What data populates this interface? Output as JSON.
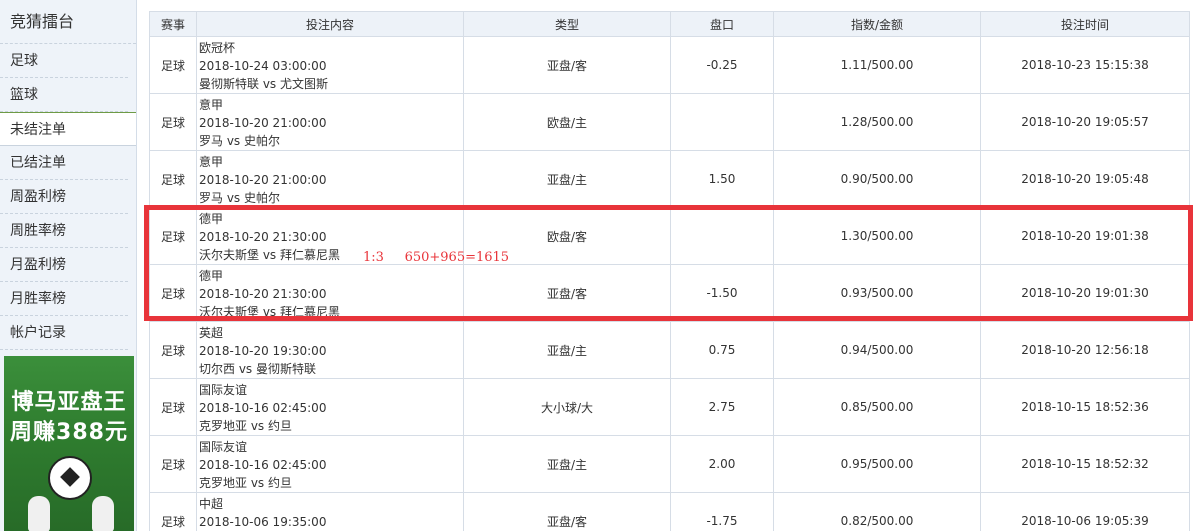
{
  "sidebar": {
    "title": "竞猜擂台",
    "items": [
      {
        "label": "足球"
      },
      {
        "label": "篮球"
      },
      {
        "label": "未结注单"
      },
      {
        "label": "已结注单"
      },
      {
        "label": "周盈利榜"
      },
      {
        "label": "周胜率榜"
      },
      {
        "label": "月盈利榜"
      },
      {
        "label": "月胜率榜"
      },
      {
        "label": "帐户记录"
      }
    ],
    "active_index": 2,
    "banner": {
      "line1": "博马亚盘王",
      "line2": "周赚388元"
    }
  },
  "table": {
    "headers": [
      "赛事",
      "投注内容",
      "类型",
      "盘口",
      "指数/金额",
      "投注时间"
    ],
    "rows": [
      {
        "sport": "足球",
        "league": "欧冠杯",
        "match_time": "2018-10-24 03:00:00",
        "teams": "曼彻斯特联 vs 尤文图斯",
        "type": "亚盘/客",
        "handicap": "-0.25",
        "odds_amount": "1.11/500.00",
        "bet_time": "2018-10-23 15:15:38"
      },
      {
        "sport": "足球",
        "league": "意甲",
        "match_time": "2018-10-20 21:00:00",
        "teams": "罗马 vs 史帕尔",
        "type": "欧盘/主",
        "handicap": "",
        "odds_amount": "1.28/500.00",
        "bet_time": "2018-10-20 19:05:57"
      },
      {
        "sport": "足球",
        "league": "意甲",
        "match_time": "2018-10-20 21:00:00",
        "teams": "罗马 vs 史帕尔",
        "type": "亚盘/主",
        "handicap": "1.50",
        "odds_amount": "0.90/500.00",
        "bet_time": "2018-10-20 19:05:48"
      },
      {
        "sport": "足球",
        "league": "德甲",
        "match_time": "2018-10-20 21:30:00",
        "teams": "沃尔夫斯堡 vs 拜仁慕尼黑",
        "type": "欧盘/客",
        "handicap": "",
        "odds_amount": "1.30/500.00",
        "bet_time": "2018-10-20 19:01:38"
      },
      {
        "sport": "足球",
        "league": "德甲",
        "match_time": "2018-10-20 21:30:00",
        "teams": "沃尔夫斯堡 vs 拜仁慕尼黑",
        "type": "亚盘/客",
        "handicap": "-1.50",
        "odds_amount": "0.93/500.00",
        "bet_time": "2018-10-20 19:01:30"
      },
      {
        "sport": "足球",
        "league": "英超",
        "match_time": "2018-10-20 19:30:00",
        "teams": "切尔西 vs 曼彻斯特联",
        "type": "亚盘/主",
        "handicap": "0.75",
        "odds_amount": "0.94/500.00",
        "bet_time": "2018-10-20 12:56:18"
      },
      {
        "sport": "足球",
        "league": "国际友谊",
        "match_time": "2018-10-16 02:45:00",
        "teams": "克罗地亚 vs 约旦",
        "type": "大小球/大",
        "handicap": "2.75",
        "odds_amount": "0.85/500.00",
        "bet_time": "2018-10-15 18:52:36"
      },
      {
        "sport": "足球",
        "league": "国际友谊",
        "match_time": "2018-10-16 02:45:00",
        "teams": "克罗地亚 vs 约旦",
        "type": "亚盘/主",
        "handicap": "2.00",
        "odds_amount": "0.95/500.00",
        "bet_time": "2018-10-15 18:52:32"
      },
      {
        "sport": "足球",
        "league": "中超",
        "match_time": "2018-10-06 19:35:00",
        "teams": "",
        "type": "亚盘/客",
        "handicap": "-1.75",
        "odds_amount": "0.82/500.00",
        "bet_time": "2018-10-06 19:05:39"
      }
    ]
  },
  "annotation": {
    "text": "1:3     650+965=1615",
    "color": "#e8343a"
  }
}
